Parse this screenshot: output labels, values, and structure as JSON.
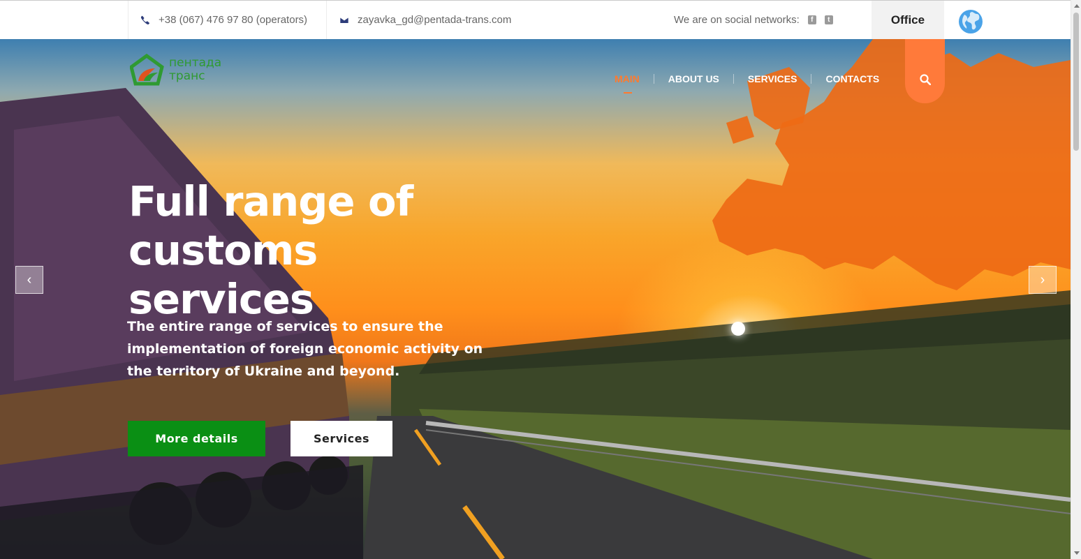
{
  "topbar": {
    "phone": "+38 (067) 476 97 80 (operators)",
    "email": "zayavka_gd@pentada-trans.com",
    "social_label": "We are on social networks:",
    "social": [
      {
        "icon": "facebook-icon",
        "glyph": "f"
      },
      {
        "icon": "tumblr-icon",
        "glyph": "t"
      }
    ],
    "office_label": "Office"
  },
  "brand": {
    "logo_line1": "пентада",
    "logo_line2": "транс",
    "logo_color": "#2f9a32",
    "logo_accent": "#e0531f"
  },
  "nav": {
    "items": [
      {
        "label": "MAIN",
        "active": true
      },
      {
        "label": "ABOUT US",
        "active": false
      },
      {
        "label": "SERVICES",
        "active": false
      },
      {
        "label": "CONTACTS",
        "active": false
      }
    ],
    "accent": "#ff7a2e"
  },
  "hero": {
    "headline": "Full range of customs services",
    "subtitle": "The entire range of services to ensure the implementation of foreign economic activity on the territory of Ukraine and beyond.",
    "primary_button": "More details",
    "secondary_button": "Services",
    "primary_color": "#0a8f14",
    "prev_arrow": "‹",
    "next_arrow": "›"
  }
}
